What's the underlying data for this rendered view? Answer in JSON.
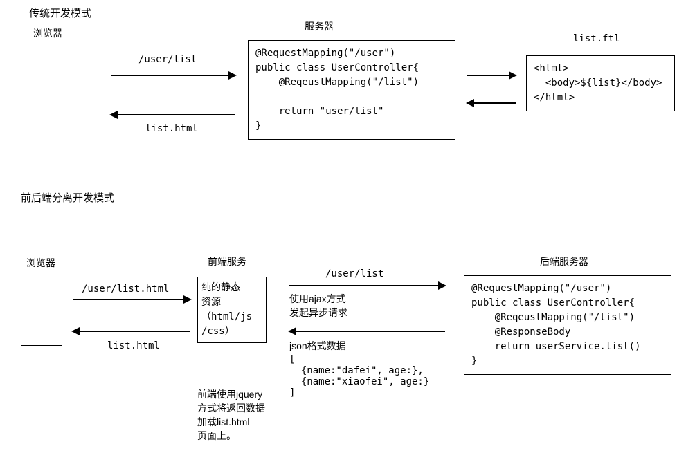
{
  "section1": {
    "title": "传统开发模式",
    "browser_label": "浏览器",
    "server_label": "服务器",
    "template_label": "list.ftl",
    "arrow_top": "/user/list",
    "arrow_bottom": "list.html",
    "server_code": "@RequestMapping(\"/user\")\npublic class UserController{\n    @ReqeustMapping(\"/list\")\n\n    return \"user/list\"\n}",
    "template_code": "<html>\n  <body>${list}</body>\n</html>"
  },
  "section2": {
    "title": "前后端分离开发模式",
    "browser_label": "浏览器",
    "frontend_label": "前端服务",
    "backend_label": "后端服务器",
    "arrow1_top": "/user/list.html",
    "arrow1_bottom": "list.html",
    "frontend_box": "纯的静态\n资源\n（html/js\n/css）",
    "arrow2_top": "/user/list",
    "arrow2_mid": "使用ajax方式\n发起异步请求",
    "arrow2_bottom": "json格式数据",
    "json_sample": "[\n  {name:\"dafei\", age:},\n  {name:\"xiaofei\", age:}\n]",
    "frontend_note": "前端使用jquery\n方式将返回数据\n加载list.html\n页面上。",
    "backend_code": "@RequestMapping(\"/user\")\npublic class UserController{\n    @ReqeustMapping(\"/list\")\n    @ResponseBody\n    return userService.list()\n}"
  }
}
